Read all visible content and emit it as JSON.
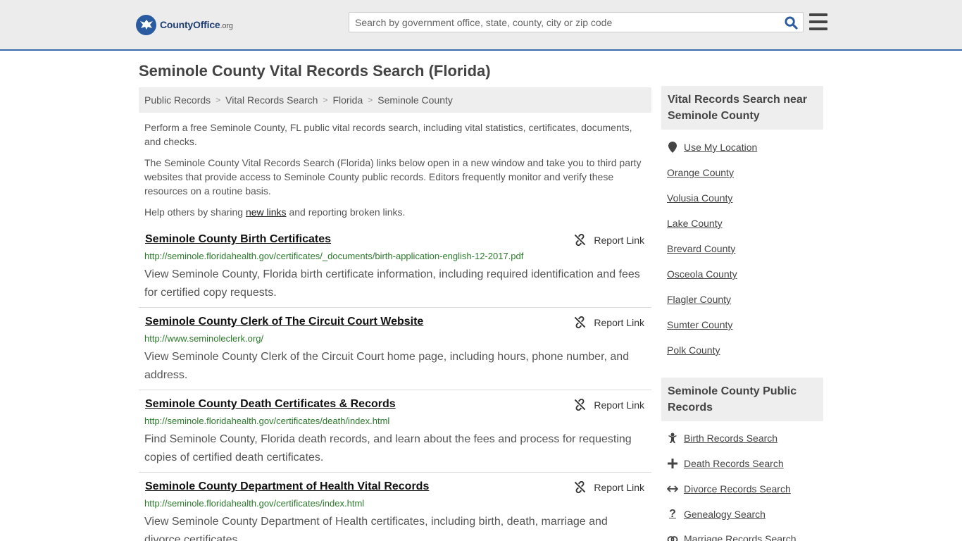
{
  "header": {
    "logo_brand": "CountyOffice",
    "logo_tld": ".org",
    "search_placeholder": "Search by government office, state, county, city or zip code"
  },
  "page": {
    "title": "Seminole County Vital Records Search (Florida)"
  },
  "breadcrumb": [
    "Public Records",
    "Vital Records Search",
    "Florida",
    "Seminole County"
  ],
  "intro": {
    "p1": "Perform a free Seminole County, FL public vital records search, including vital statistics, certificates, documents, and checks.",
    "p2": "The Seminole County Vital Records Search (Florida) links below open in a new window and take you to third party websites that provide access to Seminole County public records. Editors frequently monitor and verify these resources on a routine basis.",
    "p3_before": "Help others by sharing ",
    "p3_link": "new links",
    "p3_after": " and reporting broken links."
  },
  "report_label": "Report Link",
  "records": [
    {
      "title": "Seminole County Birth Certificates",
      "url": "http://seminole.floridahealth.gov/certificates/_documents/birth-application-english-12-2017.pdf",
      "desc": "View Seminole County, Florida birth certificate information, including required identification and fees for certified copy requests."
    },
    {
      "title": "Seminole County Clerk of The Circuit Court Website",
      "url": "http://www.seminoleclerk.org/",
      "desc": "View Seminole County Clerk of the Circuit Court home page, including hours, phone number, and address."
    },
    {
      "title": "Seminole County Death Certificates & Records",
      "url": "http://seminole.floridahealth.gov/certificates/death/index.html",
      "desc": "Find Seminole County, Florida death records, and learn about the fees and process for requesting copies of certified death certificates."
    },
    {
      "title": "Seminole County Department of Health Vital Records",
      "url": "http://seminole.floridahealth.gov/certificates/index.html",
      "desc": "View Seminole County Department of Health certificates, including birth, death, marriage and divorce certificates."
    }
  ],
  "sidebar": {
    "nearby_heading": "Vital Records Search near Seminole County",
    "use_location": "Use My Location",
    "nearby": [
      "Orange County",
      "Volusia County",
      "Lake County",
      "Brevard County",
      "Osceola County",
      "Flagler County",
      "Sumter County",
      "Polk County"
    ],
    "public_heading": "Seminole County Public Records",
    "public_links": [
      {
        "label": "Birth Records Search",
        "icon": "baby-icon"
      },
      {
        "label": "Death Records Search",
        "icon": "cross-icon"
      },
      {
        "label": "Divorce Records Search",
        "icon": "arrows-icon"
      },
      {
        "label": "Genealogy Search",
        "icon": "question-icon"
      },
      {
        "label": "Marriage Records Search",
        "icon": "rings-icon"
      }
    ]
  },
  "colors": {
    "accent": "#3b6bad",
    "url_green": "#2b7a2b",
    "header_bg": "#ececec"
  }
}
